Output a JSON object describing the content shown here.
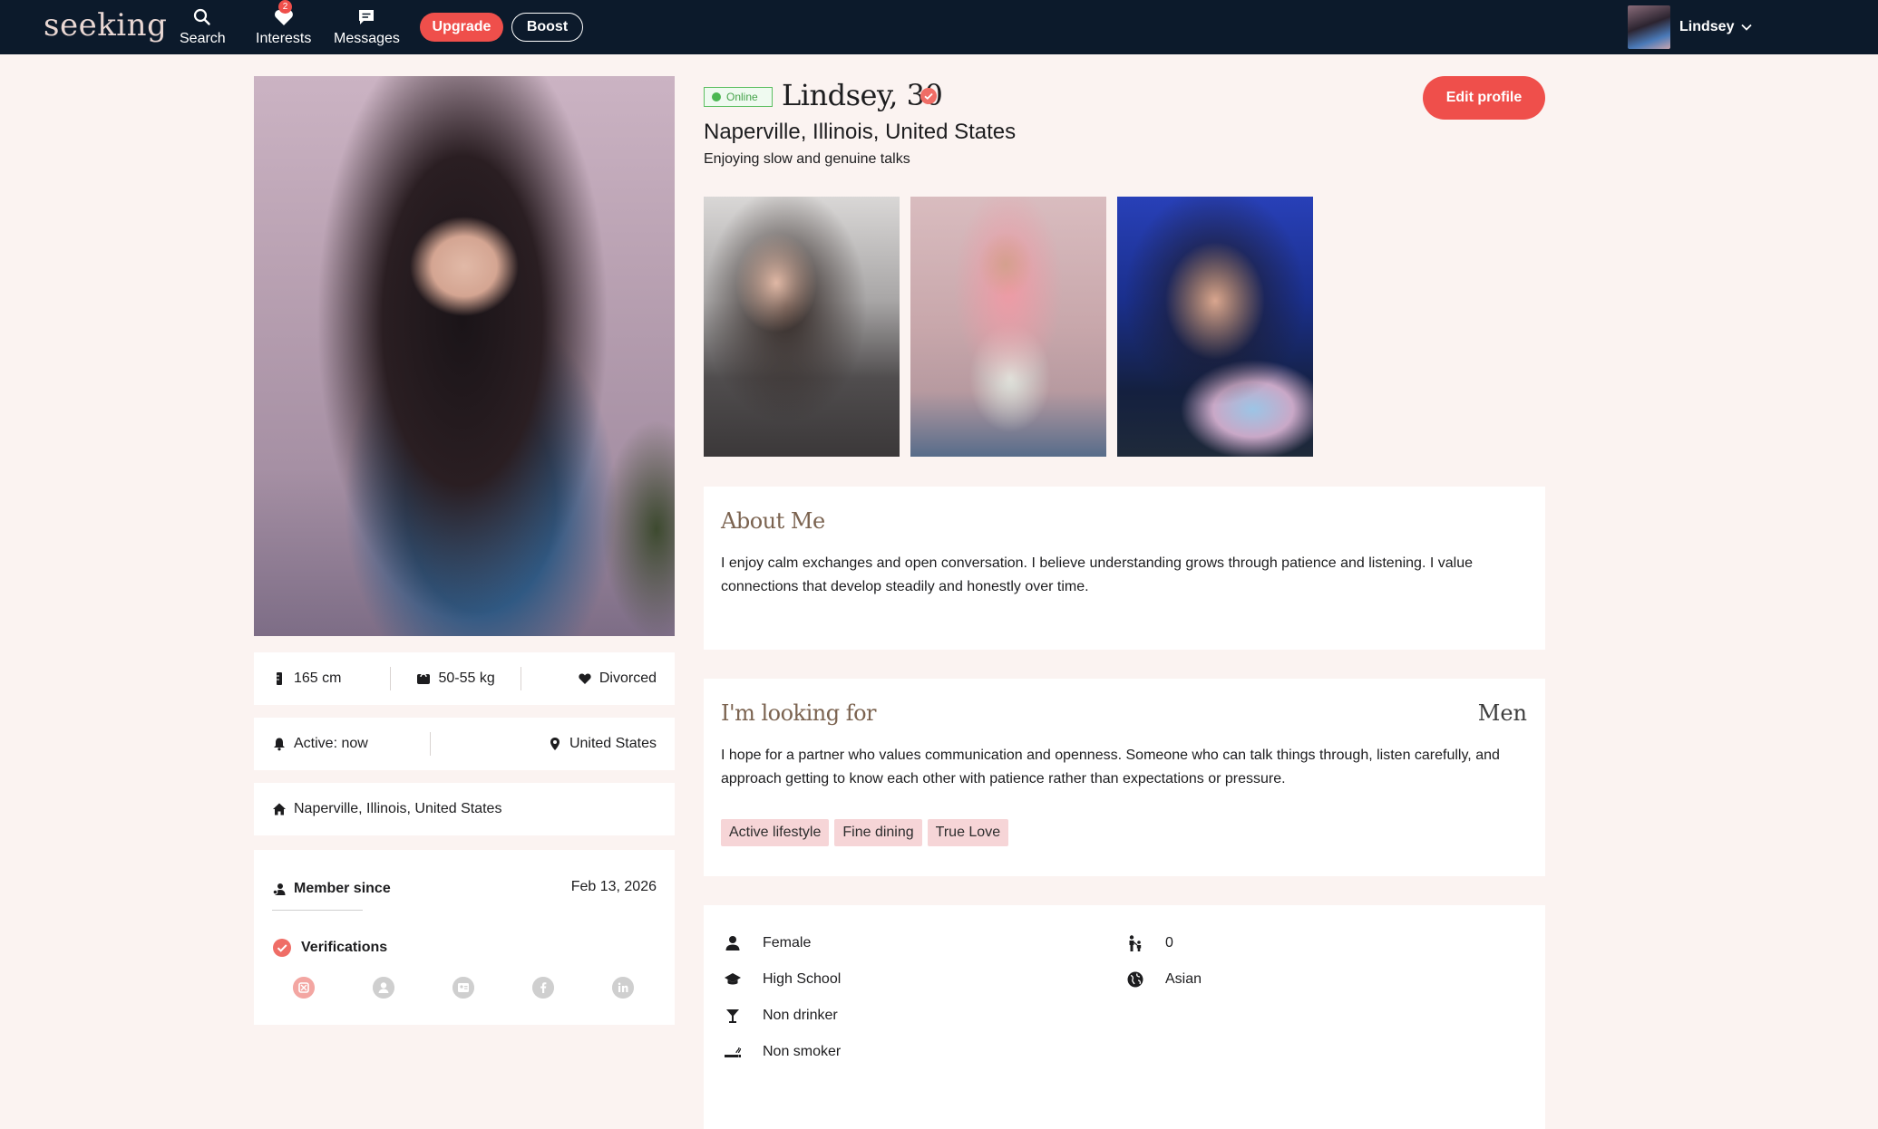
{
  "nav": {
    "logo": "seeking",
    "items": [
      {
        "label": "Search",
        "icon": "search-icon"
      },
      {
        "label": "Interests",
        "icon": "heart-icon",
        "badge": "2"
      },
      {
        "label": "Messages",
        "icon": "message-icon"
      }
    ],
    "upgrade_label": "Upgrade",
    "boost_label": "Boost",
    "user_name": "Lindsey"
  },
  "profile": {
    "status": "Online",
    "name_age": "Lindsey, 30",
    "location": "Naperville, Illinois, United States",
    "tagline": "Enjoying slow and genuine talks",
    "edit_label": "Edit profile"
  },
  "stats": {
    "height": "165 cm",
    "weight": "50-55 kg",
    "relationship": "Divorced",
    "active": "Active: now",
    "country": "United States",
    "home": "Naperville, Illinois, United States",
    "member_since_label": "Member since",
    "member_since_date": "Feb 13, 2026",
    "verifications_label": "Verifications"
  },
  "about": {
    "title": "About Me",
    "text": "I enjoy calm exchanges and open conversation. I believe understanding grows through patience and listening. I value connections that develop steadily and honestly over time."
  },
  "looking_for": {
    "title": "I'm looking for",
    "target": "Men",
    "text": "I hope for a partner who values communication and openness. Someone who can talk things through, listen carefully, and approach getting to know each other with patience rather than expectations or pressure.",
    "tags": [
      "Active lifestyle",
      "Fine dining",
      "True Love"
    ]
  },
  "details": {
    "gender": "Female",
    "education": "High School",
    "drinking": "Non drinker",
    "smoking": "Non smoker",
    "children": "0",
    "ethnicity": "Asian"
  },
  "colors": {
    "accent": "#ef4f4b",
    "nav_bg": "#0c1a2b",
    "page_bg": "#fbf3f1",
    "online": "#4bb752",
    "tag_bg": "#f6d5d7",
    "section_title": "#7b6350"
  }
}
